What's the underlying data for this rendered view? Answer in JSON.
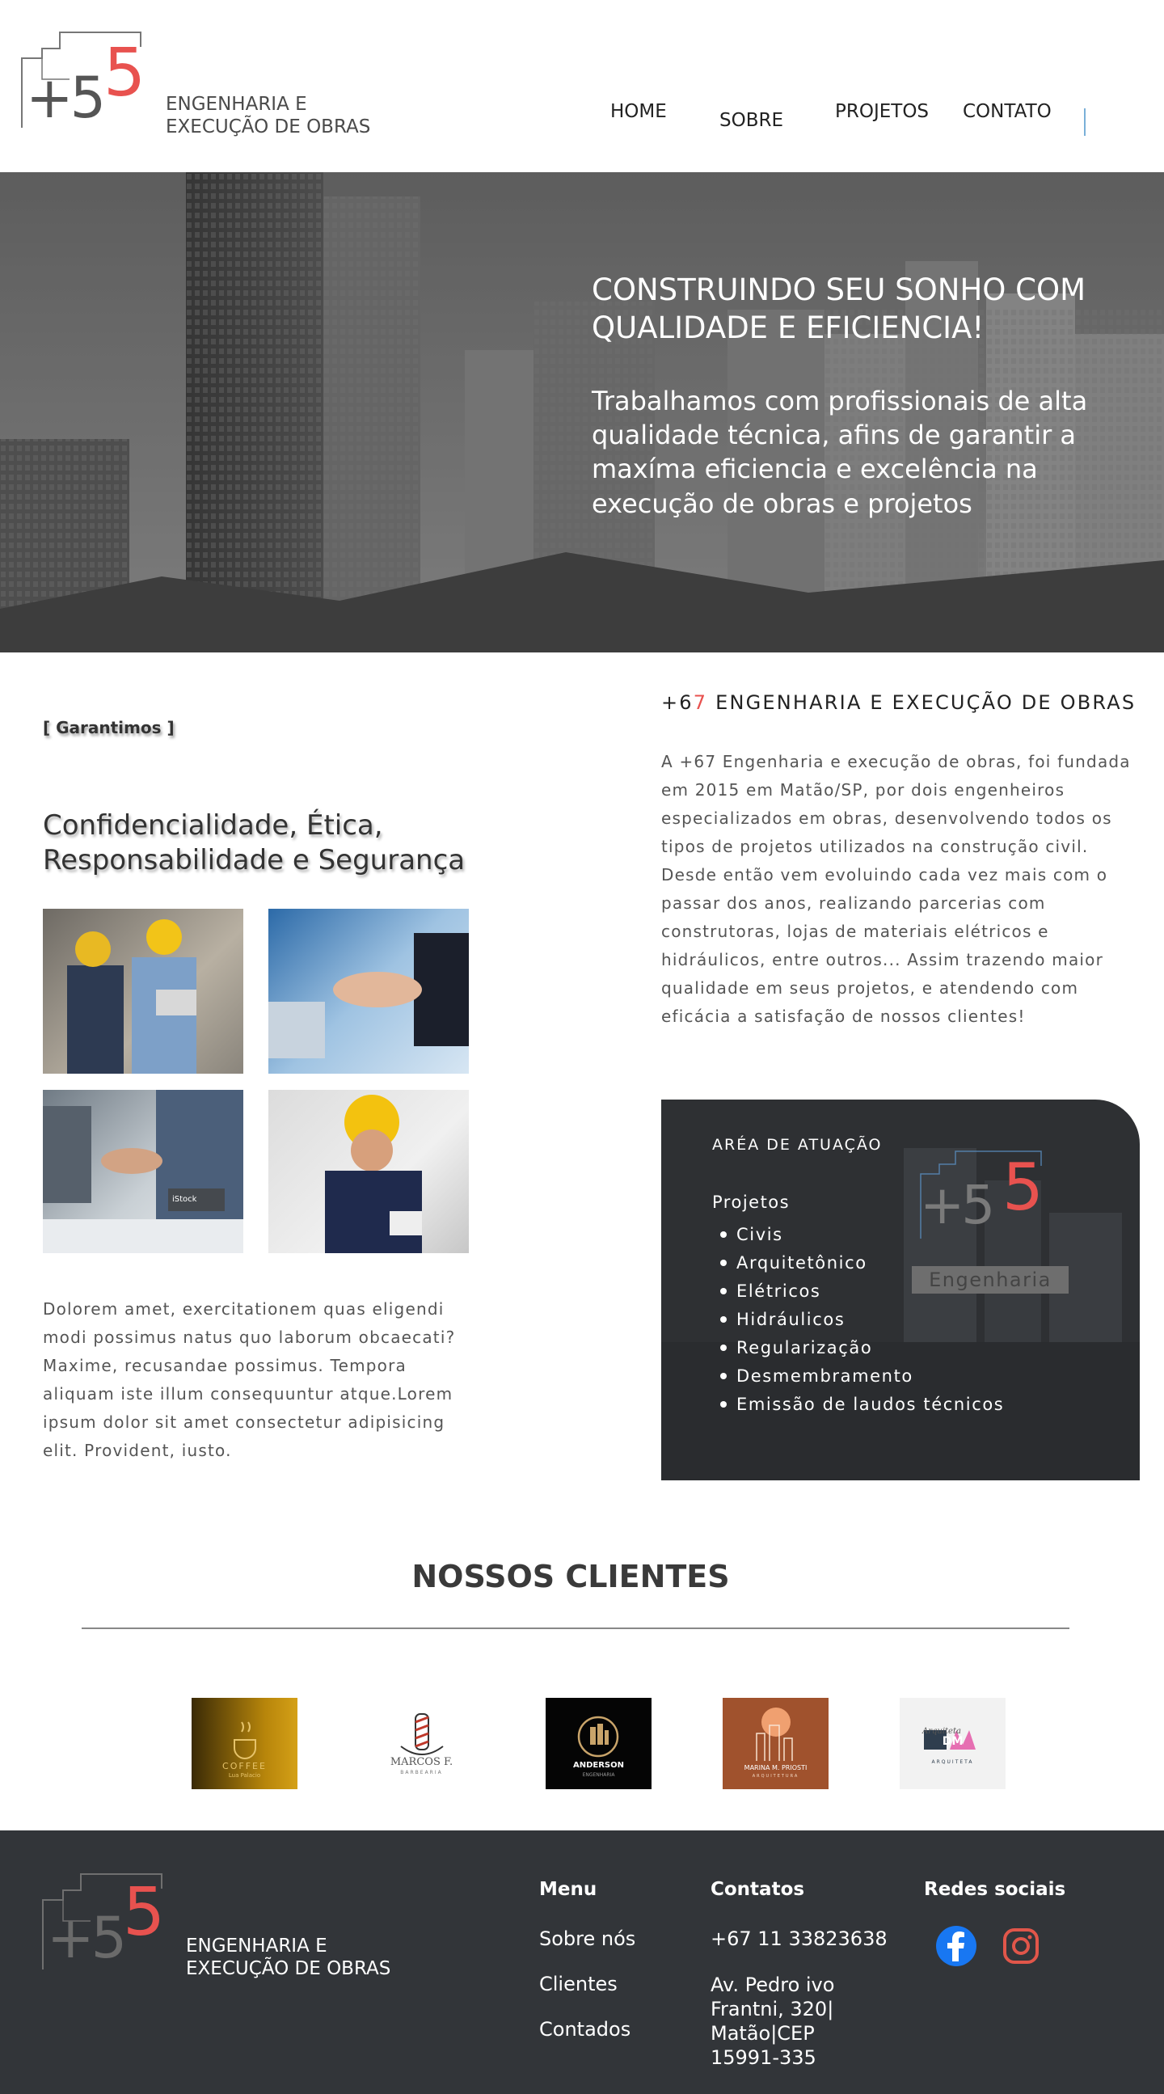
{
  "header": {
    "logo": {
      "plus": "+5",
      "five": "5"
    },
    "brand_line1": "ENGENHARIA E",
    "brand_line2": "EXECUÇÃO DE OBRAS",
    "nav": [
      "HOME",
      "SOBRE",
      "PROJETOS",
      "CONTATO"
    ]
  },
  "hero": {
    "title": "CONSTRUINDO SEU SONHO COM QUALIDADE E EFICIENCIA!",
    "text": "Trabalhamos com profissionais de alta qualidade técnica, afins de garantir a maxíma eficiencia e excelência na execução de obras e projetos"
  },
  "guarantees": {
    "tag": "[ Garantimos ]",
    "title_line1": "Confidencialidade, Ética,",
    "title_line2": "Responsabilidade e Segurança",
    "photos": [
      "engineers-with-tablet",
      "handshake-city",
      "handshake-office",
      "engineer-with-clipboard"
    ],
    "stock_label": "iStock",
    "text": "Dolorem amet, exercitationem quas eligendi modi possimus natus quo laborum obcaecati? Maxime, recusandae possimus. Tempora aliquam iste illum consequuntur atque.Lorem ipsum dolor sit amet consectetur adipisicing elit. Provident, iusto."
  },
  "about": {
    "title_prefix": "+6",
    "title_red": "7",
    "title_rest": " ENGENHARIA E EXECUÇÃO DE OBRAS",
    "text": "A +67 Engenharia e execução de obras, foi fundada em 2015 em Matão/SP, por dois engenheiros especializados em obras, desenvolvendo todos os tipos de projetos utilizados na construção civil. Desde então vem evoluindo cada vez mais com o passar dos anos, realizando parcerias com construtoras, lojas de materiais elétricos e hidráulicos, entre outros... Assim trazendo maior qualidade em seus projetos, e atendendo com eficácia a satisfação de nossos clientes!"
  },
  "area": {
    "title": "ARÉA DE ATUAÇÃO",
    "subtitle": "Projetos",
    "items": [
      "Civis",
      "Arquitetônico",
      "Elétricos",
      "Hidráulicos",
      "Regularização",
      "Desmembramento",
      "Emissão de laudos técnicos"
    ],
    "watermark_tag": "Engenharia"
  },
  "clients": {
    "title": "NOSSOS CLIENTES",
    "logos": [
      {
        "name": "coffee-logo",
        "line1": "COFFEE",
        "line2": "Lua Palacio"
      },
      {
        "name": "marcos-barber-logo",
        "line1": "MARCOS F.",
        "line2": "BARBEARIA"
      },
      {
        "name": "anderson-logo",
        "line1": "ANDERSON",
        "line2": "ENGENHARIA"
      },
      {
        "name": "marina-priosti-logo",
        "line1": "MARINA M. PRIOSTI",
        "line2": "ARQUITETURA"
      },
      {
        "name": "dm-arquiteta-logo",
        "line1": "DM",
        "line2": "ARQUITETA"
      }
    ]
  },
  "footer": {
    "brand_line1": "ENGENHARIA E",
    "brand_line2": "EXECUÇÃO DE OBRAS",
    "menu_title": "Menu",
    "menu": [
      "Sobre nós",
      "Clientes",
      "Contados"
    ],
    "contacts_title": "Contatos",
    "phone": "+67 11 33823638",
    "address_lines": [
      "Av. Pedro ivo",
      "Frantni, 320|",
      "Matão|CEP",
      "15991-335"
    ],
    "social_title": "Redes sociais",
    "social_icons": [
      "facebook-icon",
      "instagram-icon"
    ],
    "colors": {
      "accent_red": "#e8524f",
      "footer_bg": "#323539",
      "facebook": "#1877f2",
      "instagram": "#e1564a"
    }
  }
}
